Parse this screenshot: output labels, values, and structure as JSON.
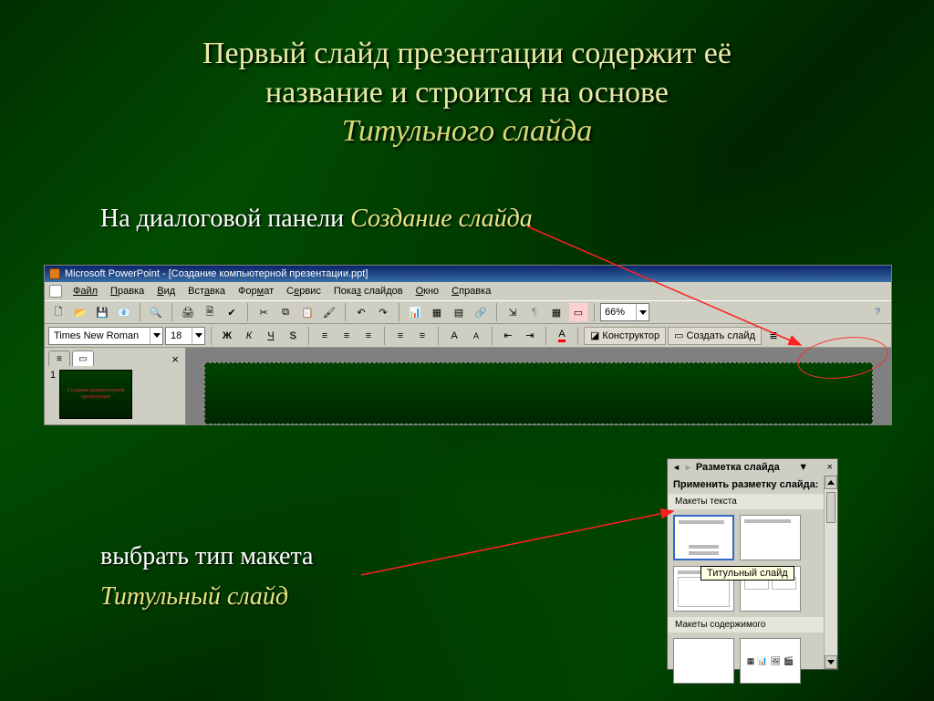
{
  "title": {
    "line1": "Первый слайд презентации содержит её",
    "line2": "название и строится на основе",
    "line3": "Титульного слайда"
  },
  "lead": {
    "plain": "На диалоговой панели  ",
    "em": "Создание слайда"
  },
  "ppt": {
    "titlebar": "Microsoft PowerPoint - [Создание компьютерной презентации.ppt]",
    "menus": [
      "Файл",
      "Правка",
      "Вид",
      "Вставка",
      "Формат",
      "Сервис",
      "Показ слайдов",
      "Окно",
      "Справка"
    ],
    "zoom": "66%",
    "font": "Times New Roman",
    "size": "18",
    "bold": "Ж",
    "italic": "К",
    "underline": "Ч",
    "shadow": "S",
    "designer": "Конструктор",
    "newslide": "Создать слайд",
    "thumb_num": "1",
    "thumb_text": "Создание\nкомпьютерной\nпрезентации",
    "close_x": "×"
  },
  "pane": {
    "title": "Разметка слайда",
    "apply": "Применить разметку слайда:",
    "h1": "Макеты текста",
    "h2": "Макеты содержимого",
    "tooltip": "Титульный слайд",
    "dd": "▼",
    "x": "×"
  },
  "captions": {
    "c1": "выбрать тип макета",
    "c2": "Титульный слайд"
  }
}
